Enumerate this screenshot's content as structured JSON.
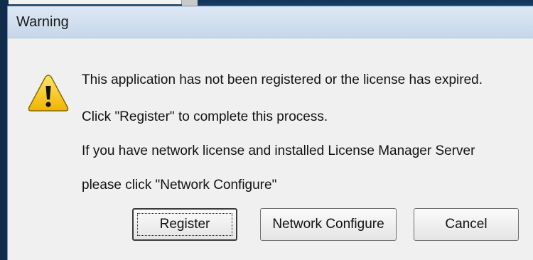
{
  "dialog": {
    "title": "Warning",
    "icon": "warning-icon",
    "messages": [
      "This application has not been registered or the license has expired.",
      "Click \"Register\" to complete this process.",
      "If you have network license and installed License Manager Server",
      "please click \"Network Configure\""
    ],
    "buttons": {
      "register": "Register",
      "network_configure": "Network Configure",
      "cancel": "Cancel"
    }
  },
  "colors": {
    "titlebar": "#c6d7ea",
    "dialog_bg": "#f0f0f0",
    "warning_fill": "#f5c400",
    "desktop_bg": "#17385e"
  }
}
